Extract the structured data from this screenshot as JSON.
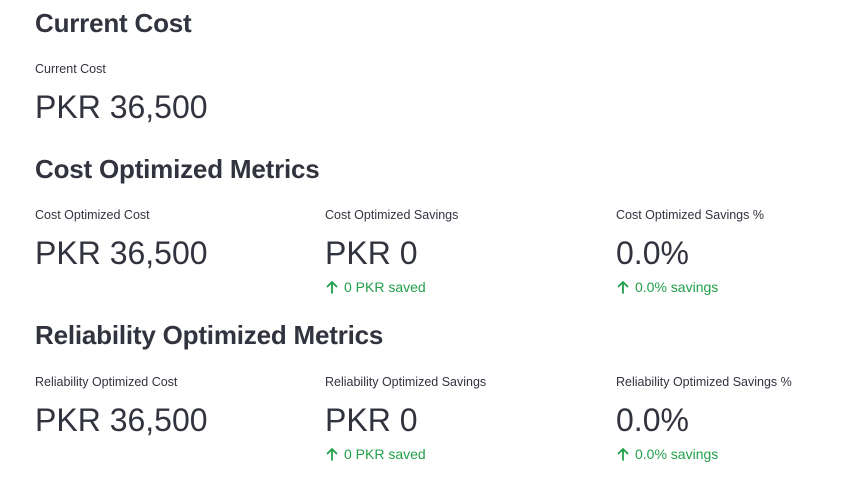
{
  "current": {
    "title": "Current Cost",
    "metrics": [
      {
        "label": "Current Cost",
        "value": "PKR 36,500"
      }
    ]
  },
  "cost_optimized": {
    "title": "Cost Optimized Metrics",
    "metrics": [
      {
        "label": "Cost Optimized Cost",
        "value": "PKR 36,500"
      },
      {
        "label": "Cost Optimized Savings",
        "value": "PKR 0",
        "delta": "0 PKR saved"
      },
      {
        "label": "Cost Optimized Savings %",
        "value": "0.0%",
        "delta": "0.0% savings"
      }
    ]
  },
  "reliability_optimized": {
    "title": "Reliability Optimized Metrics",
    "metrics": [
      {
        "label": "Reliability Optimized Cost",
        "value": "PKR 36,500"
      },
      {
        "label": "Reliability Optimized Savings",
        "value": "PKR 0",
        "delta": "0 PKR saved"
      },
      {
        "label": "Reliability Optimized Savings %",
        "value": "0.0%",
        "delta": "0.0% savings"
      }
    ]
  },
  "colors": {
    "text": "#31333f",
    "delta_positive": "#21a04a",
    "background": "#ffffff"
  },
  "icons": {
    "delta": "arrow-up-icon"
  }
}
